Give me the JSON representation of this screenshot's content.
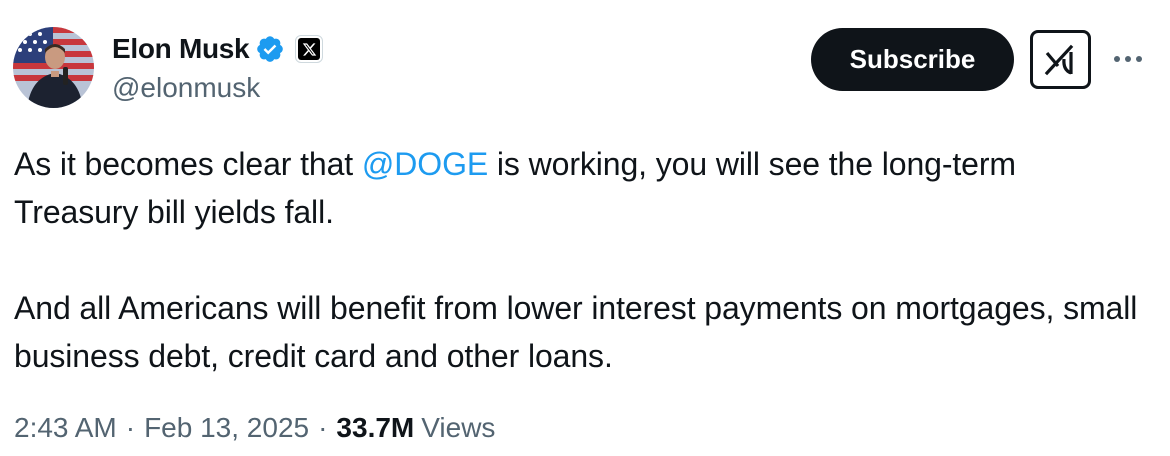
{
  "author": {
    "display_name": "Elon Musk",
    "handle": "@elonmusk",
    "verified": true,
    "affiliate_icon": "x-logo-icon",
    "avatar_icon": "profile-photo"
  },
  "actions": {
    "subscribe_label": "Subscribe",
    "grok_icon": "grok-icon",
    "more_icon": "more-options-icon"
  },
  "tweet": {
    "line1_before": "As it becomes clear that ",
    "mention": "@DOGE",
    "line1_after": " is working, you will see the long-term Treasury bill yields fall.",
    "paragraph2": "And all Americans will benefit from lower interest payments on mortgages, small business debt, credit card and other loans."
  },
  "meta": {
    "time": "2:43 AM",
    "separator": "·",
    "date": "Feb 13, 2025",
    "views_count": "33.7M",
    "views_label": "Views"
  },
  "colors": {
    "text": "#0f1419",
    "secondary": "#536471",
    "link": "#1d9bf0",
    "verified": "#1d9bf0",
    "button_bg": "#0f1419"
  }
}
